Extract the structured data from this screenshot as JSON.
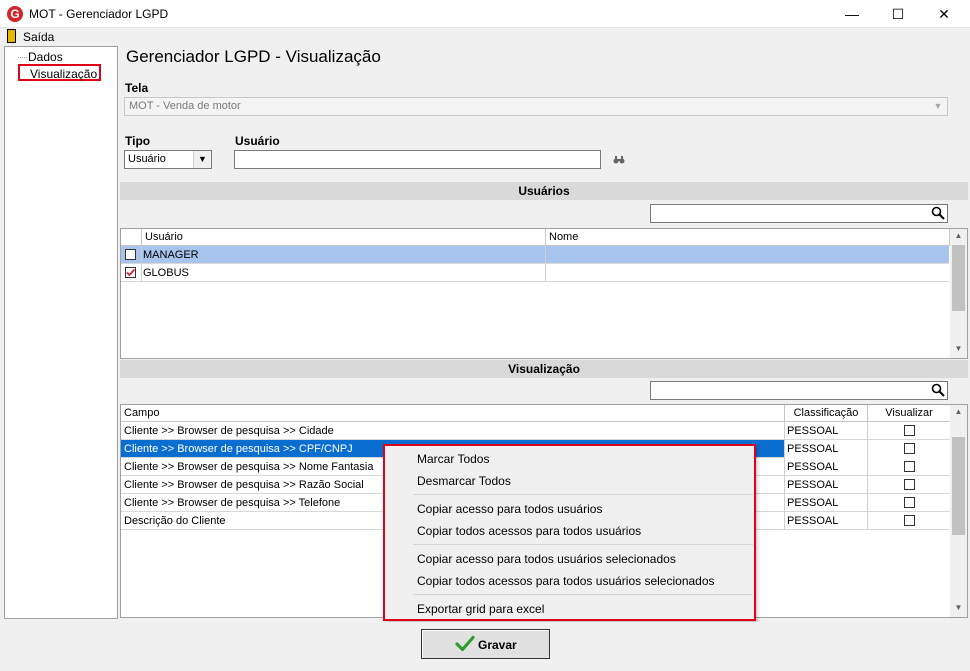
{
  "window": {
    "title": "MOT - Gerenciador LGPD",
    "logo_letter": "G",
    "min_icon": "—",
    "max_icon": "☐",
    "close_icon": "✕"
  },
  "menu": {
    "exit_label": "Saída"
  },
  "tree": {
    "items": [
      {
        "label": "Dados"
      },
      {
        "label": "Visualização"
      }
    ]
  },
  "page": {
    "title": "Gerenciador LGPD - Visualização"
  },
  "filters": {
    "tela_label": "Tela",
    "tela_value": "MOT - Venda de motor",
    "tipo_label": "Tipo",
    "tipo_value": "Usuário",
    "usuario_label": "Usuário",
    "usuario_value": ""
  },
  "users_section": {
    "header": "Usuários",
    "search_value": "",
    "columns": [
      "Usuário",
      "Nome"
    ],
    "rows": [
      {
        "usuario": "MANAGER",
        "nome": "",
        "checked": false,
        "selected": true
      },
      {
        "usuario": "GLOBUS",
        "nome": "",
        "checked": true,
        "selected": false
      }
    ]
  },
  "visualizacao_section": {
    "header": "Visualização",
    "search_value": "",
    "columns": [
      "Campo",
      "Classificação",
      "Visualizar"
    ],
    "rows": [
      {
        "campo": "Cliente >> Browser de pesquisa >> Cidade",
        "classificacao": "PESSOAL",
        "visualizar": false
      },
      {
        "campo": "Cliente >> Browser de pesquisa >> CPF/CNPJ",
        "classificacao": "PESSOAL",
        "visualizar": false,
        "selected": true
      },
      {
        "campo": "Cliente >> Browser de pesquisa >> Nome Fantasia",
        "classificacao": "PESSOAL",
        "visualizar": false
      },
      {
        "campo": "Cliente >> Browser de pesquisa >> Razão Social",
        "classificacao": "PESSOAL",
        "visualizar": false
      },
      {
        "campo": "Cliente >> Browser de pesquisa >> Telefone",
        "classificacao": "PESSOAL",
        "visualizar": false
      },
      {
        "campo": "Descrição do Cliente",
        "classificacao": "PESSOAL",
        "visualizar": false
      }
    ]
  },
  "context_menu": {
    "items": [
      "Marcar Todos",
      "Desmarcar Todos",
      "Copiar acesso para todos usuários",
      "Copiar todos acessos para todos usuários",
      "Copiar acesso para todos usuários selecionados",
      "Copiar todos acessos para todos usuários selecionados",
      "Exportar grid para excel"
    ]
  },
  "footer": {
    "save_label": "Gravar"
  },
  "colors": {
    "highlight_border": "#e0001a",
    "selected_row_user": "#a6c4ec",
    "selected_row_visu": "#0a6ed1",
    "check_green": "#2e9d2e"
  }
}
